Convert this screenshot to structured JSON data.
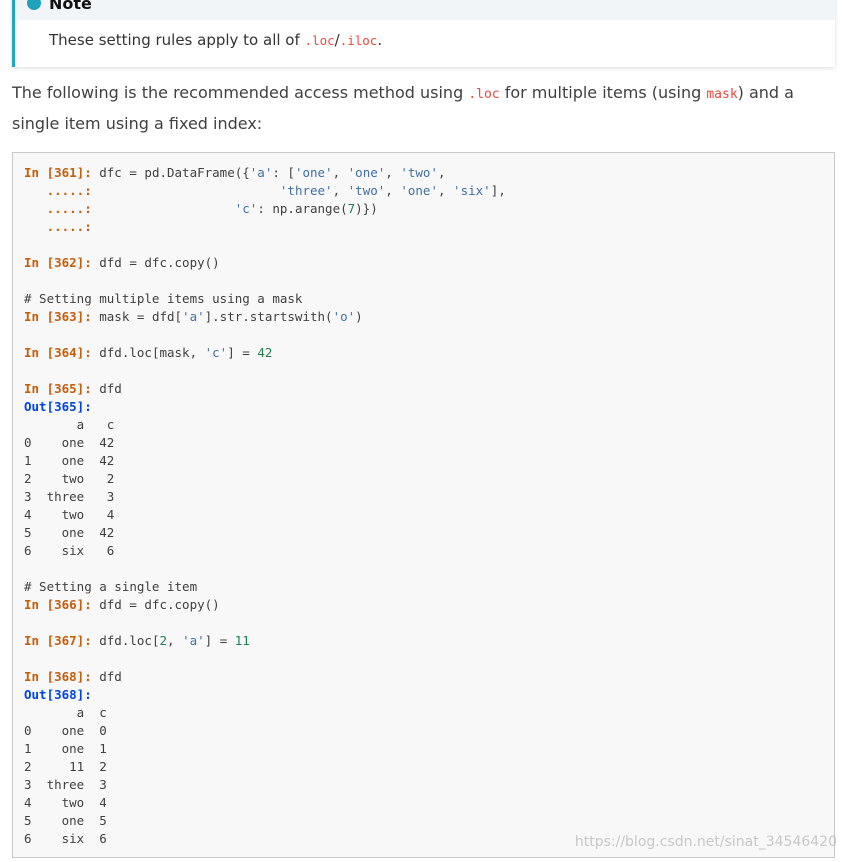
{
  "note": {
    "title": "Note",
    "text_before": "These setting rules apply to all of ",
    "code1": ".loc",
    "slash": "/",
    "code2": ".iloc",
    "text_after": "."
  },
  "paragraph": {
    "t1": "The following is the recommended access method using ",
    "c1": ".loc",
    "t2": " for multiple items (using ",
    "c2": "mask",
    "t3": ") and a single item using a fixed index:"
  },
  "code_lines": [
    [
      {
        "t": "In [361]:",
        "c": "prompt-in"
      },
      {
        "t": " dfc = pd.DataFrame({"
      },
      {
        "t": "'a'",
        "c": "str"
      },
      {
        "t": ": ["
      },
      {
        "t": "'one'",
        "c": "str"
      },
      {
        "t": ", "
      },
      {
        "t": "'one'",
        "c": "str"
      },
      {
        "t": ", "
      },
      {
        "t": "'two'",
        "c": "str"
      },
      {
        "t": ","
      }
    ],
    [
      {
        "t": "   .....:",
        "c": "prompt-in"
      },
      {
        "t": "                         "
      },
      {
        "t": "'three'",
        "c": "str"
      },
      {
        "t": ", "
      },
      {
        "t": "'two'",
        "c": "str"
      },
      {
        "t": ", "
      },
      {
        "t": "'one'",
        "c": "str"
      },
      {
        "t": ", "
      },
      {
        "t": "'six'",
        "c": "str"
      },
      {
        "t": "],"
      }
    ],
    [
      {
        "t": "   .....:",
        "c": "prompt-in"
      },
      {
        "t": "                   "
      },
      {
        "t": "'c'",
        "c": "str"
      },
      {
        "t": ": np.arange("
      },
      {
        "t": "7",
        "c": "num"
      },
      {
        "t": ")})"
      }
    ],
    [
      {
        "t": "   .....:",
        "c": "prompt-in"
      }
    ],
    [],
    [
      {
        "t": "In [362]:",
        "c": "prompt-in"
      },
      {
        "t": " dfd = dfc.copy()"
      }
    ],
    [],
    [
      {
        "t": "# Setting multiple items using a mask",
        "c": "cmt"
      }
    ],
    [
      {
        "t": "In [363]:",
        "c": "prompt-in"
      },
      {
        "t": " mask = dfd["
      },
      {
        "t": "'a'",
        "c": "str"
      },
      {
        "t": "].str.startswith("
      },
      {
        "t": "'o'",
        "c": "str"
      },
      {
        "t": ")"
      }
    ],
    [],
    [
      {
        "t": "In [364]:",
        "c": "prompt-in"
      },
      {
        "t": " dfd.loc[mask, "
      },
      {
        "t": "'c'",
        "c": "str"
      },
      {
        "t": "] = "
      },
      {
        "t": "42",
        "c": "num"
      }
    ],
    [],
    [
      {
        "t": "In [365]:",
        "c": "prompt-in"
      },
      {
        "t": " dfd"
      }
    ],
    [
      {
        "t": "Out[365]:",
        "c": "prompt-out"
      }
    ],
    [
      {
        "t": "       a   c"
      }
    ],
    [
      {
        "t": "0    one  42"
      }
    ],
    [
      {
        "t": "1    one  42"
      }
    ],
    [
      {
        "t": "2    two   2"
      }
    ],
    [
      {
        "t": "3  three   3"
      }
    ],
    [
      {
        "t": "4    two   4"
      }
    ],
    [
      {
        "t": "5    one  42"
      }
    ],
    [
      {
        "t": "6    six   6"
      }
    ],
    [],
    [
      {
        "t": "# Setting a single item",
        "c": "cmt"
      }
    ],
    [
      {
        "t": "In [366]:",
        "c": "prompt-in"
      },
      {
        "t": " dfd = dfc.copy()"
      }
    ],
    [],
    [
      {
        "t": "In [367]:",
        "c": "prompt-in"
      },
      {
        "t": " dfd.loc["
      },
      {
        "t": "2",
        "c": "num"
      },
      {
        "t": ", "
      },
      {
        "t": "'a'",
        "c": "str"
      },
      {
        "t": "] = "
      },
      {
        "t": "11",
        "c": "num"
      }
    ],
    [],
    [
      {
        "t": "In [368]:",
        "c": "prompt-in"
      },
      {
        "t": " dfd"
      }
    ],
    [
      {
        "t": "Out[368]:",
        "c": "prompt-out"
      }
    ],
    [
      {
        "t": "       a  c"
      }
    ],
    [
      {
        "t": "0    one  0"
      }
    ],
    [
      {
        "t": "1    one  1"
      }
    ],
    [
      {
        "t": "2     11  2"
      }
    ],
    [
      {
        "t": "3  three  3"
      }
    ],
    [
      {
        "t": "4    two  4"
      }
    ],
    [
      {
        "t": "5    one  5"
      }
    ],
    [
      {
        "t": "6    six  6"
      }
    ]
  ],
  "watermark": "https://blog.csdn.net/sinat_34546420"
}
